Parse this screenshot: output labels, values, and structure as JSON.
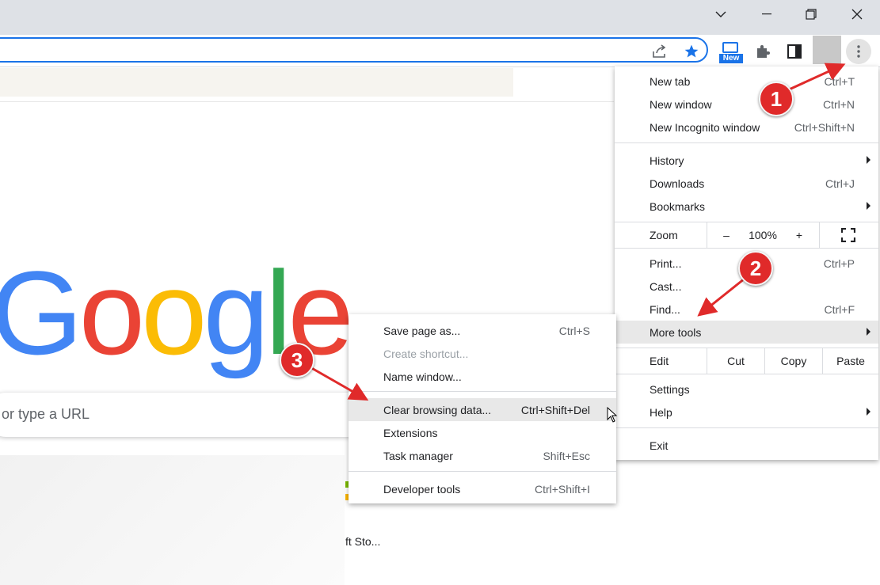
{
  "window": {
    "controls": [
      "tab-search",
      "minimize",
      "restore",
      "close"
    ]
  },
  "toolbar": {
    "new_badge": "New",
    "icons": [
      "share-icon",
      "bookmark-star-icon",
      "new-app-icon",
      "extensions-puzzle-icon",
      "side-panel-icon",
      "profile-avatar",
      "kebab-menu-icon"
    ]
  },
  "page": {
    "logo": [
      "G",
      "o",
      "o",
      "g",
      "l",
      "e"
    ],
    "logo_colors": [
      "#4285f4",
      "#ea4335",
      "#fbbc05",
      "#4285f4",
      "#34a853",
      "#ea4335"
    ],
    "search_placeholder": "or type a URL",
    "shortcut_label": "ft Sto..."
  },
  "main_menu": {
    "items": {
      "new_tab": {
        "label": "New tab",
        "shortcut": "Ctrl+T"
      },
      "new_window": {
        "label": "New window",
        "shortcut": "Ctrl+N"
      },
      "new_incognito": {
        "label": "New Incognito window",
        "shortcut": "Ctrl+Shift+N"
      },
      "history": {
        "label": "History"
      },
      "downloads": {
        "label": "Downloads",
        "shortcut": "Ctrl+J"
      },
      "bookmarks": {
        "label": "Bookmarks"
      },
      "print": {
        "label": "Print...",
        "shortcut": "Ctrl+P"
      },
      "cast": {
        "label": "Cast..."
      },
      "find": {
        "label": "Find...",
        "shortcut": "Ctrl+F"
      },
      "more_tools": {
        "label": "More tools"
      },
      "settings": {
        "label": "Settings"
      },
      "help": {
        "label": "Help"
      },
      "exit": {
        "label": "Exit"
      }
    },
    "zoom": {
      "label": "Zoom",
      "minus": "–",
      "value": "100%",
      "plus": "+"
    },
    "edit": {
      "label": "Edit",
      "cut": "Cut",
      "copy": "Copy",
      "paste": "Paste"
    }
  },
  "submenu": {
    "items": {
      "save_page": {
        "label": "Save page as...",
        "shortcut": "Ctrl+S"
      },
      "create_shortcut": {
        "label": "Create shortcut..."
      },
      "name_window": {
        "label": "Name window..."
      },
      "clear_browsing": {
        "label": "Clear browsing data...",
        "shortcut": "Ctrl+Shift+Del"
      },
      "extensions": {
        "label": "Extensions"
      },
      "task_manager": {
        "label": "Task manager",
        "shortcut": "Shift+Esc"
      },
      "developer_tools": {
        "label": "Developer tools",
        "shortcut": "Ctrl+Shift+I"
      }
    }
  },
  "annotations": {
    "step1": "1",
    "step2": "2",
    "step3": "3",
    "arrow_color": "#e02a2a"
  }
}
